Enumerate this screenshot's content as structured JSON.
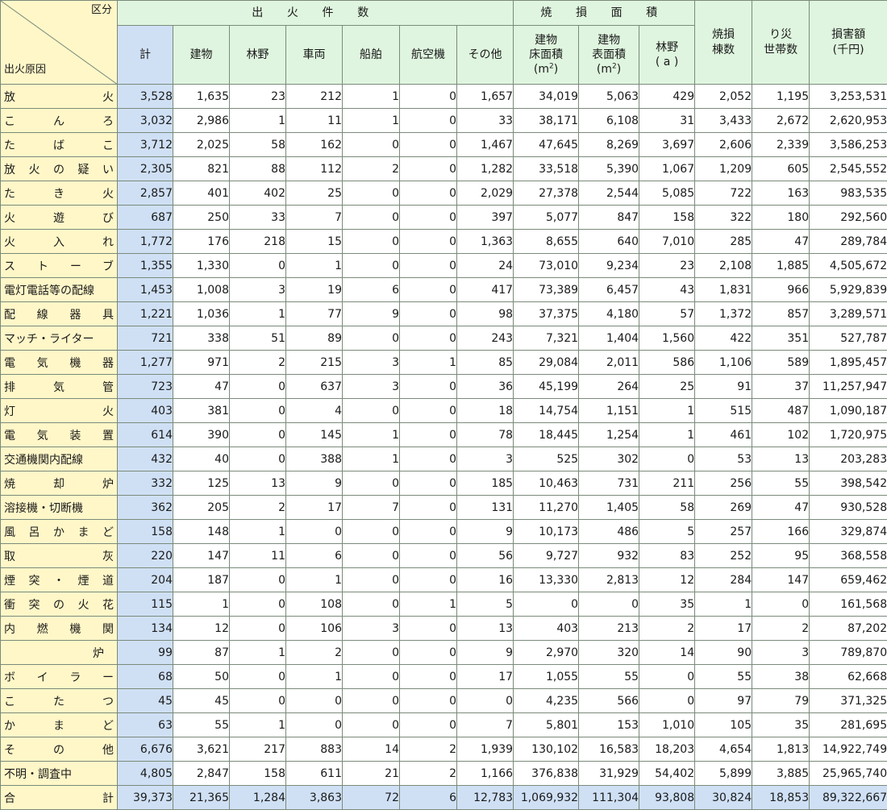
{
  "header": {
    "category_label": "区分",
    "cause_label": "出火原因",
    "group_fires": "出 火 件 数",
    "group_burned": "焼 損 面 積",
    "columns": {
      "total": "計",
      "building": "建物",
      "forest": "林野",
      "vehicle": "車両",
      "ship": "船舶",
      "aircraft": "航空機",
      "other": "その他",
      "floor_area_l1": "建物",
      "floor_area_l2": "床面積",
      "floor_area_unit": "(m",
      "surface_area_l1": "建物",
      "surface_area_l2": "表面積",
      "surface_area_unit": "(m",
      "area_exp": "2",
      "area_close": ")",
      "forest_area_l1": "林野",
      "forest_area_l2": "( a )",
      "buildings_burned_l1": "焼損",
      "buildings_burned_l2": "棟数",
      "households_l1": "り災",
      "households_l2": "世帯数",
      "damage_l1": "損害額",
      "damage_l2": "(千円)"
    }
  },
  "rows": [
    {
      "cause": "放火",
      "values": [
        "3,528",
        "1,635",
        "23",
        "212",
        "1",
        "0",
        "1,657",
        "34,019",
        "5,063",
        "429",
        "2,052",
        "1,195",
        "3,253,531"
      ]
    },
    {
      "cause": "こんろ",
      "values": [
        "3,032",
        "2,986",
        "1",
        "11",
        "1",
        "0",
        "33",
        "38,171",
        "6,108",
        "31",
        "3,433",
        "2,672",
        "2,620,953"
      ]
    },
    {
      "cause": "たばこ",
      "values": [
        "3,712",
        "2,025",
        "58",
        "162",
        "0",
        "0",
        "1,467",
        "47,645",
        "8,269",
        "3,697",
        "2,606",
        "2,339",
        "3,586,253"
      ]
    },
    {
      "cause": "放火の疑い",
      "values": [
        "2,305",
        "821",
        "88",
        "112",
        "2",
        "0",
        "1,282",
        "33,518",
        "5,390",
        "1,067",
        "1,209",
        "605",
        "2,545,552"
      ]
    },
    {
      "cause": "たき火",
      "values": [
        "2,857",
        "401",
        "402",
        "25",
        "0",
        "0",
        "2,029",
        "27,378",
        "2,544",
        "5,085",
        "722",
        "163",
        "983,535"
      ]
    },
    {
      "cause": "火遊び",
      "values": [
        "687",
        "250",
        "33",
        "7",
        "0",
        "0",
        "397",
        "5,077",
        "847",
        "158",
        "322",
        "180",
        "292,560"
      ]
    },
    {
      "cause": "火入れ",
      "values": [
        "1,772",
        "176",
        "218",
        "15",
        "0",
        "0",
        "1,363",
        "8,655",
        "640",
        "7,010",
        "285",
        "47",
        "289,784"
      ]
    },
    {
      "cause": "ストーブ",
      "values": [
        "1,355",
        "1,330",
        "0",
        "1",
        "0",
        "0",
        "24",
        "73,010",
        "9,234",
        "23",
        "2,108",
        "1,885",
        "4,505,672"
      ]
    },
    {
      "cause": "電灯電話等の配線",
      "values": [
        "1,453",
        "1,008",
        "3",
        "19",
        "6",
        "0",
        "417",
        "73,389",
        "6,457",
        "43",
        "1,831",
        "966",
        "5,929,839"
      ]
    },
    {
      "cause": "配線器具",
      "values": [
        "1,221",
        "1,036",
        "1",
        "77",
        "9",
        "0",
        "98",
        "37,375",
        "4,180",
        "57",
        "1,372",
        "857",
        "3,289,571"
      ]
    },
    {
      "cause": "マッチ・ライター",
      "values": [
        "721",
        "338",
        "51",
        "89",
        "0",
        "0",
        "243",
        "7,321",
        "1,404",
        "1,560",
        "422",
        "351",
        "527,787"
      ]
    },
    {
      "cause": "電気機器",
      "values": [
        "1,277",
        "971",
        "2",
        "215",
        "3",
        "1",
        "85",
        "29,084",
        "2,011",
        "586",
        "1,106",
        "589",
        "1,895,457"
      ]
    },
    {
      "cause": "排気管",
      "values": [
        "723",
        "47",
        "0",
        "637",
        "3",
        "0",
        "36",
        "45,199",
        "264",
        "25",
        "91",
        "37",
        "11,257,947"
      ]
    },
    {
      "cause": "灯火",
      "values": [
        "403",
        "381",
        "0",
        "4",
        "0",
        "0",
        "18",
        "14,754",
        "1,151",
        "1",
        "515",
        "487",
        "1,090,187"
      ]
    },
    {
      "cause": "電気装置",
      "values": [
        "614",
        "390",
        "0",
        "145",
        "1",
        "0",
        "78",
        "18,445",
        "1,254",
        "1",
        "461",
        "102",
        "1,720,975"
      ]
    },
    {
      "cause": "交通機関内配線",
      "values": [
        "432",
        "40",
        "0",
        "388",
        "1",
        "0",
        "3",
        "525",
        "302",
        "0",
        "53",
        "13",
        "203,283"
      ]
    },
    {
      "cause": "焼却炉",
      "values": [
        "332",
        "125",
        "13",
        "9",
        "0",
        "0",
        "185",
        "10,463",
        "731",
        "211",
        "256",
        "55",
        "398,542"
      ]
    },
    {
      "cause": "溶接機・切断機",
      "values": [
        "362",
        "205",
        "2",
        "17",
        "7",
        "0",
        "131",
        "11,270",
        "1,405",
        "58",
        "269",
        "47",
        "930,528"
      ]
    },
    {
      "cause": "風呂かまど",
      "values": [
        "158",
        "148",
        "1",
        "0",
        "0",
        "0",
        "9",
        "10,173",
        "486",
        "5",
        "257",
        "166",
        "329,874"
      ]
    },
    {
      "cause": "取灰",
      "values": [
        "220",
        "147",
        "11",
        "6",
        "0",
        "0",
        "56",
        "9,727",
        "932",
        "83",
        "252",
        "95",
        "368,558"
      ]
    },
    {
      "cause": "煙突・煙道",
      "values": [
        "204",
        "187",
        "0",
        "1",
        "0",
        "0",
        "16",
        "13,330",
        "2,813",
        "12",
        "284",
        "147",
        "659,462"
      ]
    },
    {
      "cause": "衝突の火花",
      "values": [
        "115",
        "1",
        "0",
        "108",
        "0",
        "1",
        "5",
        "0",
        "0",
        "35",
        "1",
        "0",
        "161,568"
      ]
    },
    {
      "cause": "内燃機関",
      "values": [
        "134",
        "12",
        "0",
        "106",
        "3",
        "0",
        "13",
        "403",
        "213",
        "2",
        "17",
        "2",
        "87,202"
      ]
    },
    {
      "cause": "炉",
      "values": [
        "99",
        "87",
        "1",
        "2",
        "0",
        "0",
        "9",
        "2,970",
        "320",
        "14",
        "90",
        "3",
        "789,870"
      ]
    },
    {
      "cause": "ボイラー",
      "values": [
        "68",
        "50",
        "0",
        "1",
        "0",
        "0",
        "17",
        "1,055",
        "55",
        "0",
        "55",
        "38",
        "62,668"
      ]
    },
    {
      "cause": "こたつ",
      "values": [
        "45",
        "45",
        "0",
        "0",
        "0",
        "0",
        "0",
        "4,235",
        "566",
        "0",
        "97",
        "79",
        "371,325"
      ]
    },
    {
      "cause": "かまど",
      "values": [
        "63",
        "55",
        "1",
        "0",
        "0",
        "0",
        "7",
        "5,801",
        "153",
        "1,010",
        "105",
        "35",
        "281,695"
      ]
    },
    {
      "cause": "その他",
      "values": [
        "6,676",
        "3,621",
        "217",
        "883",
        "14",
        "2",
        "1,939",
        "130,102",
        "16,583",
        "18,203",
        "4,654",
        "1,813",
        "14,922,749"
      ]
    },
    {
      "cause": "不明・調査中",
      "values": [
        "4,805",
        "2,847",
        "158",
        "611",
        "21",
        "2",
        "1,166",
        "376,838",
        "31,929",
        "54,402",
        "5,899",
        "3,885",
        "25,965,740"
      ]
    }
  ],
  "total": {
    "cause": "合計",
    "values": [
      "39,373",
      "21,365",
      "1,284",
      "3,863",
      "72",
      "6",
      "12,783",
      "1,069,932",
      "111,304",
      "93,808",
      "30,824",
      "18,853",
      "89,322,667"
    ]
  }
}
